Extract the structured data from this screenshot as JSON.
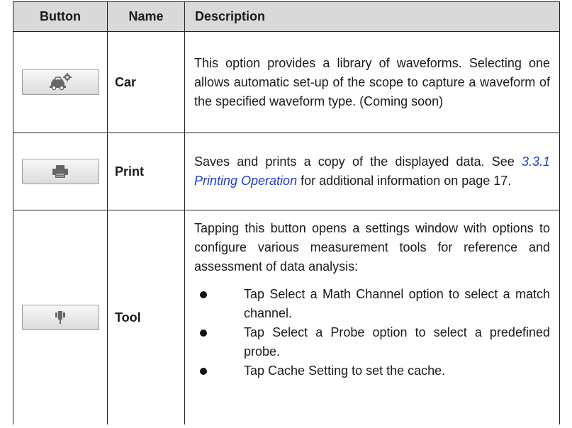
{
  "table": {
    "headers": {
      "button": "Button",
      "name": "Name",
      "description": "Description"
    },
    "rows": [
      {
        "icon": "car-settings-icon",
        "name": "Car",
        "description": "This option provides a library of waveforms. Selecting one allows automatic set-up of the scope to capture a waveform of the specified waveform type. (Coming soon)"
      },
      {
        "icon": "printer-icon",
        "name": "Print",
        "description_pre": "Saves and prints a copy of the displayed data. See ",
        "link": "3.3.1 Printing Operation",
        "description_post": " for additional information on page 17."
      },
      {
        "icon": "tool-probe-icon",
        "name": "Tool",
        "description": "Tapping this button opens a settings window with options to configure various measurement tools for reference and assessment of data analysis:",
        "bullets": [
          "Tap Select a Math Channel option to select a match channel.",
          "Tap Select a Probe option to select a predefined probe.",
          "Tap Cache Setting to set the cache."
        ]
      }
    ]
  }
}
